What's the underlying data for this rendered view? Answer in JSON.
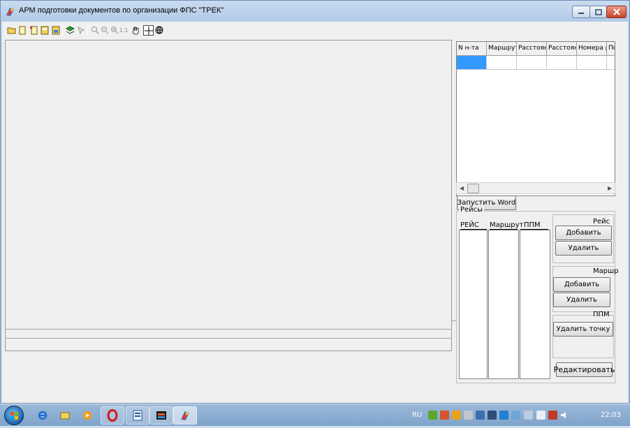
{
  "window": {
    "title": "АРМ подготовки документов по организации ФПС \"ТРЕК\""
  },
  "toolbar": {
    "icons": [
      "open-folder-icon",
      "new-doc-icon",
      "close-doc-icon",
      "save-doc-icon",
      "export-doc-icon",
      "layers-icon",
      "select-arrow-icon",
      "zoom-icon",
      "zoom-out-icon",
      "zoom-in-icon",
      "pan-hand-icon",
      "crosshair-icon",
      "globe-icon"
    ],
    "zoom_actual_label": "1:1"
  },
  "grid": {
    "columns": [
      "N н-та",
      "Маршрут",
      "Расстоян",
      "Расстоян",
      "Номера р",
      "По"
    ]
  },
  "launch_word_button": "Запустить Word",
  "reisy": {
    "legend": "Рейсы",
    "list_headers": [
      "РЕЙС",
      "Маршрут",
      "ППМ"
    ],
    "reis_group": {
      "title": "Рейс",
      "add": "Добавить",
      "delete": "Удалить"
    },
    "route_group": {
      "title": "Маршр",
      "add": "Добавить",
      "delete": "Удалить"
    },
    "ppm_group": {
      "title": "ППМ",
      "delete_point": "Удалить точку"
    },
    "edit_button": "Редактировать"
  },
  "tray": {
    "language": "RU",
    "clock": "22:03"
  },
  "colors": {
    "selection": "#3399ff",
    "window_frame": "#bcd2ea",
    "taskbar": "#8fb0d3"
  }
}
